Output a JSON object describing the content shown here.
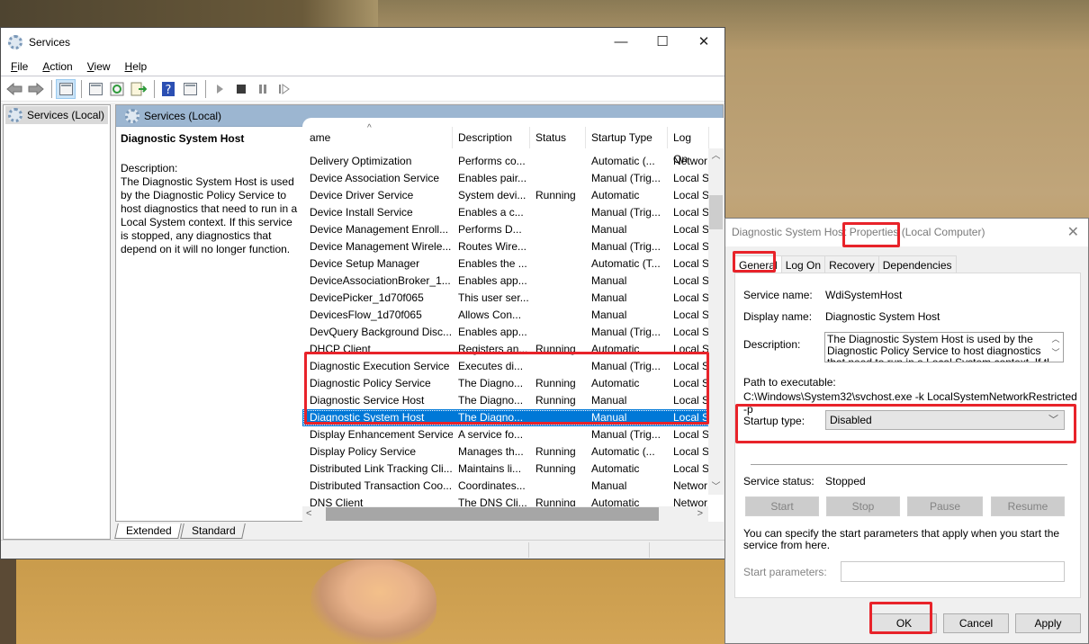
{
  "window": {
    "title": "Services",
    "controls": {
      "minimize": "—",
      "maximize": "☐",
      "close": "✕"
    }
  },
  "menu": {
    "items": [
      {
        "label": "File",
        "accel": "F",
        "rest": "ile"
      },
      {
        "label": "Action",
        "accel": "A",
        "rest": "ction"
      },
      {
        "label": "View",
        "accel": "V",
        "rest": "iew"
      },
      {
        "label": "Help",
        "accel": "H",
        "rest": "elp"
      }
    ]
  },
  "toolbar": {
    "icons": [
      "back-icon",
      "forward-icon",
      "show-hide-console-tree-icon",
      "properties-icon",
      "refresh-icon",
      "export-list-icon",
      "help-icon",
      "show-action-pane-icon",
      "start-service-icon",
      "stop-service-icon",
      "pause-service-icon",
      "resume-service-icon"
    ]
  },
  "tree": {
    "root": "Services (Local)"
  },
  "pane": {
    "header": "Services (Local)",
    "detail": {
      "title": "Diagnostic System Host",
      "description_label": "Description:",
      "description": "The Diagnostic System Host is used by the Diagnostic Policy Service to host diagnostics that need to run in a Local System context.  If this service is stopped, any diagnostics that depend on it will no longer function."
    }
  },
  "list": {
    "columns": [
      "ame",
      "Description",
      "Status",
      "Startup Type",
      "Log On"
    ],
    "sort_indicator": "^",
    "rows": [
      {
        "name": "Delivery Optimization",
        "description": "Performs co...",
        "status": "",
        "startup": "Automatic (...",
        "logon": "Networ"
      },
      {
        "name": "Device Association Service",
        "description": "Enables pair...",
        "status": "",
        "startup": "Manual (Trig...",
        "logon": "Local Sy"
      },
      {
        "name": "Device Driver Service",
        "description": "System devi...",
        "status": "Running",
        "startup": "Automatic",
        "logon": "Local Sy"
      },
      {
        "name": "Device Install Service",
        "description": "Enables a c...",
        "status": "",
        "startup": "Manual (Trig...",
        "logon": "Local Sy"
      },
      {
        "name": "Device Management Enroll...",
        "description": "Performs D...",
        "status": "",
        "startup": "Manual",
        "logon": "Local Sy"
      },
      {
        "name": "Device Management Wirele...",
        "description": "Routes Wire...",
        "status": "",
        "startup": "Manual (Trig...",
        "logon": "Local Sy"
      },
      {
        "name": "Device Setup Manager",
        "description": "Enables the ...",
        "status": "",
        "startup": "Automatic (T...",
        "logon": "Local Sy"
      },
      {
        "name": "DeviceAssociationBroker_1...",
        "description": "Enables app...",
        "status": "",
        "startup": "Manual",
        "logon": "Local Sy"
      },
      {
        "name": "DevicePicker_1d70f065",
        "description": "This user ser...",
        "status": "",
        "startup": "Manual",
        "logon": "Local Sy"
      },
      {
        "name": "DevicesFlow_1d70f065",
        "description": "Allows Con...",
        "status": "",
        "startup": "Manual",
        "logon": "Local Sy"
      },
      {
        "name": "DevQuery Background Disc...",
        "description": "Enables app...",
        "status": "",
        "startup": "Manual (Trig...",
        "logon": "Local Sy"
      },
      {
        "name": "DHCP Client",
        "description": "Registers an...",
        "status": "Running",
        "startup": "Automatic",
        "logon": "Local S"
      },
      {
        "name": "Diagnostic Execution Service",
        "description": "Executes di...",
        "status": "",
        "startup": "Manual (Trig...",
        "logon": "Local S"
      },
      {
        "name": "Diagnostic Policy Service",
        "description": "The Diagno...",
        "status": "Running",
        "startup": "Automatic",
        "logon": "Local S"
      },
      {
        "name": "Diagnostic Service Host",
        "description": "The Diagno...",
        "status": "Running",
        "startup": "Manual",
        "logon": "Local S"
      },
      {
        "name": "Diagnostic System Host",
        "description": "The Diagno...",
        "status": "",
        "startup": "Manual",
        "logon": "Local S",
        "selected": true
      },
      {
        "name": "Display Enhancement Service",
        "description": "A service fo...",
        "status": "",
        "startup": "Manual (Trig...",
        "logon": "Local Sy"
      },
      {
        "name": "Display Policy Service",
        "description": "Manages th...",
        "status": "Running",
        "startup": "Automatic (...",
        "logon": "Local S"
      },
      {
        "name": "Distributed Link Tracking Cli...",
        "description": "Maintains li...",
        "status": "Running",
        "startup": "Automatic",
        "logon": "Local Sy"
      },
      {
        "name": "Distributed Transaction Coo...",
        "description": "Coordinates...",
        "status": "",
        "startup": "Manual",
        "logon": "Networ"
      },
      {
        "name": "DNS Client",
        "description": "The DNS Cli...",
        "status": "Running",
        "startup": "Automatic",
        "logon": "Networ"
      }
    ]
  },
  "view_tabs": [
    "Extended",
    "Standard"
  ],
  "dialog": {
    "title": "Diagnostic System Host Properties (Local Computer)",
    "close": "✕",
    "tabs": [
      "General",
      "Log On",
      "Recovery",
      "Dependencies"
    ],
    "service_name_label": "Service name:",
    "service_name": "WdiSystemHost",
    "display_name_label": "Display name:",
    "display_name": "Diagnostic System Host",
    "description_label": "Description:",
    "description": "The Diagnostic System Host is used by the Diagnostic Policy Service to host diagnostics that need to run in a Local System context.  If this",
    "path_label": "Path to executable:",
    "path": "C:\\Windows\\System32\\svchost.exe -k LocalSystemNetworkRestricted -p",
    "startup_type_label": "Startup type:",
    "startup_type": "Disabled",
    "status_label": "Service status:",
    "status": "Stopped",
    "buttons": {
      "start": "Start",
      "stop": "Stop",
      "pause": "Pause",
      "resume": "Resume"
    },
    "params_hint": "You can specify the start parameters that apply when you start the service from here.",
    "params_label": "Start parameters:",
    "params_value": "",
    "ok": "OK",
    "cancel": "Cancel",
    "apply": "Apply"
  },
  "colors": {
    "selection": "#0078d7",
    "highlight_box": "#e8232a",
    "pane_header": "#9cb6d1"
  }
}
